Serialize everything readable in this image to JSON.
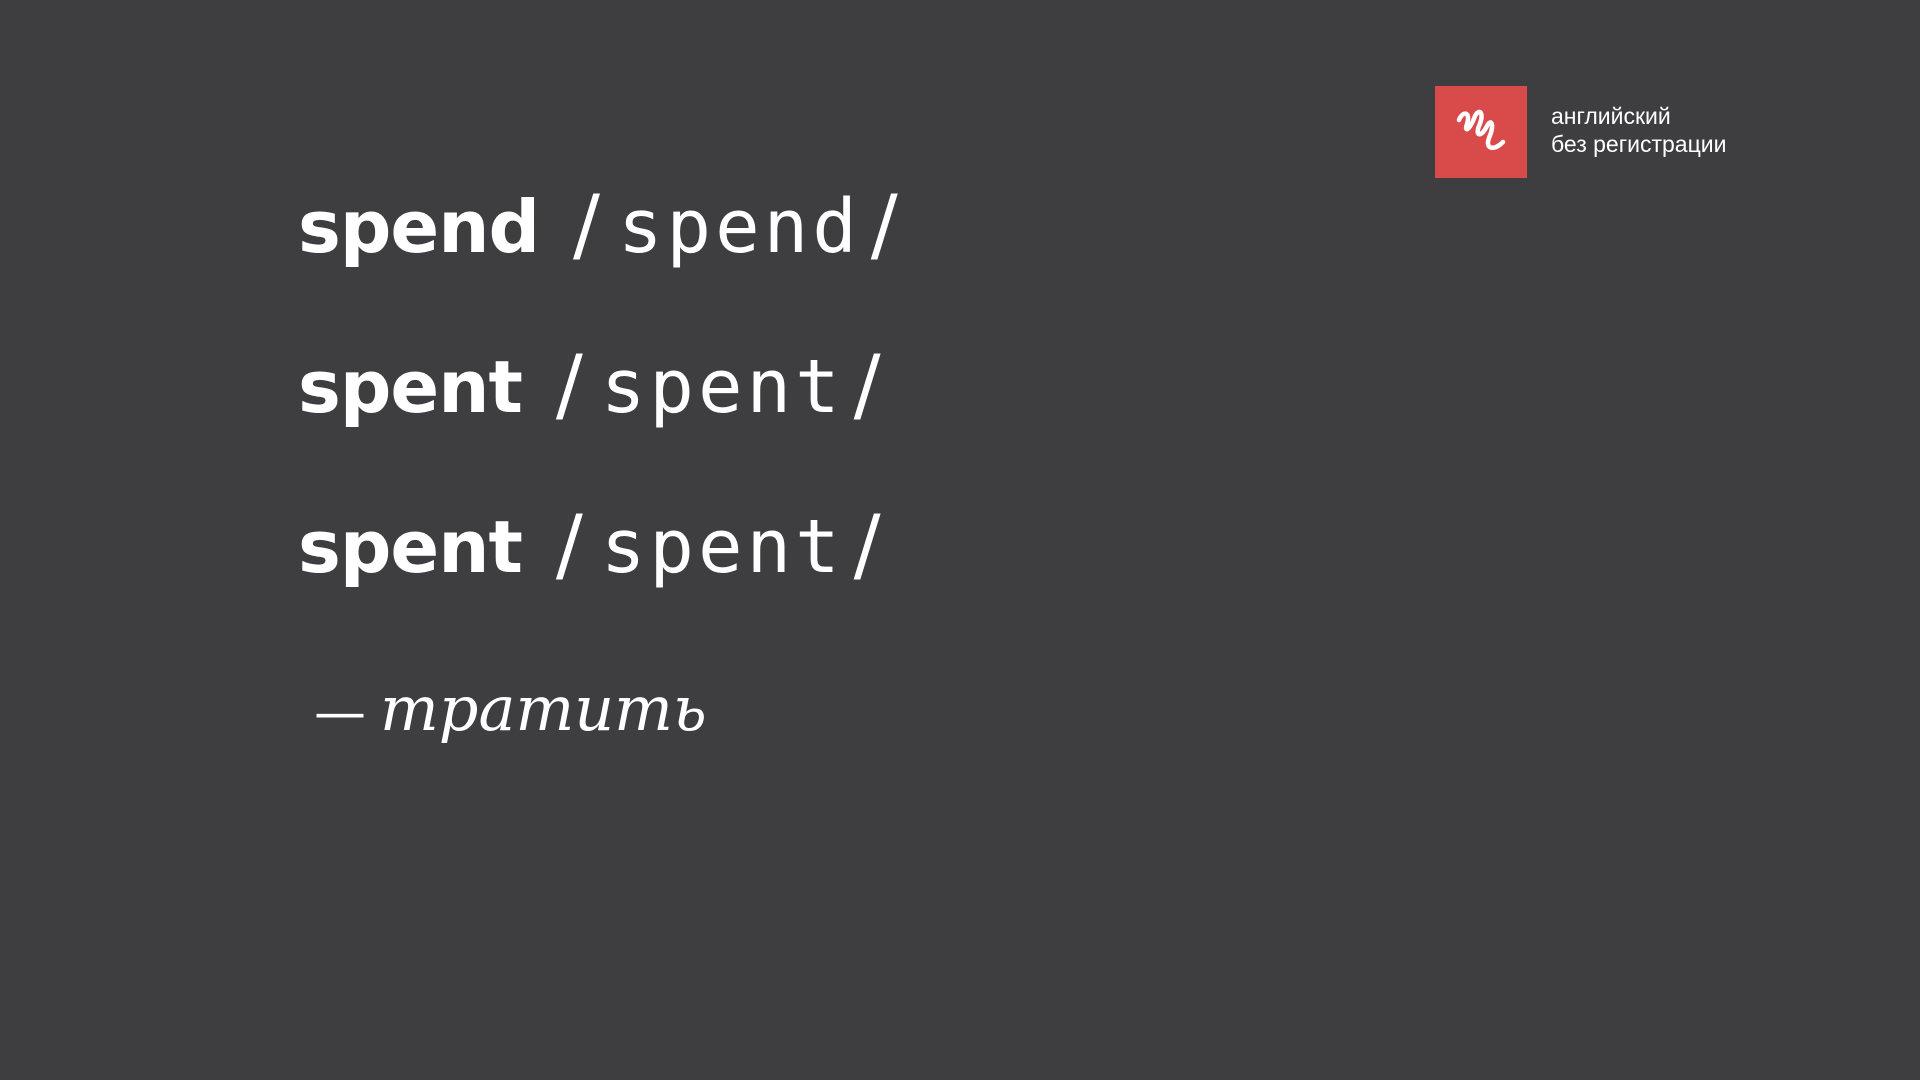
{
  "logo": {
    "icon": "scribble-logo-icon",
    "line1": "английский",
    "line2": "без регистрации",
    "color": "#d94a4b"
  },
  "forms": [
    {
      "word": "spend",
      "slash_open": "/",
      "pron": "spend",
      "slash_close": "/"
    },
    {
      "word": "spent",
      "slash_open": "/",
      "pron": "spent",
      "slash_close": "/"
    },
    {
      "word": "spent",
      "slash_open": "/",
      "pron": "spent",
      "slash_close": "/"
    }
  ],
  "translation": {
    "dash": "—",
    "text": "тратить"
  },
  "colors": {
    "background": "#3e3d40",
    "text": "#ffffff"
  }
}
